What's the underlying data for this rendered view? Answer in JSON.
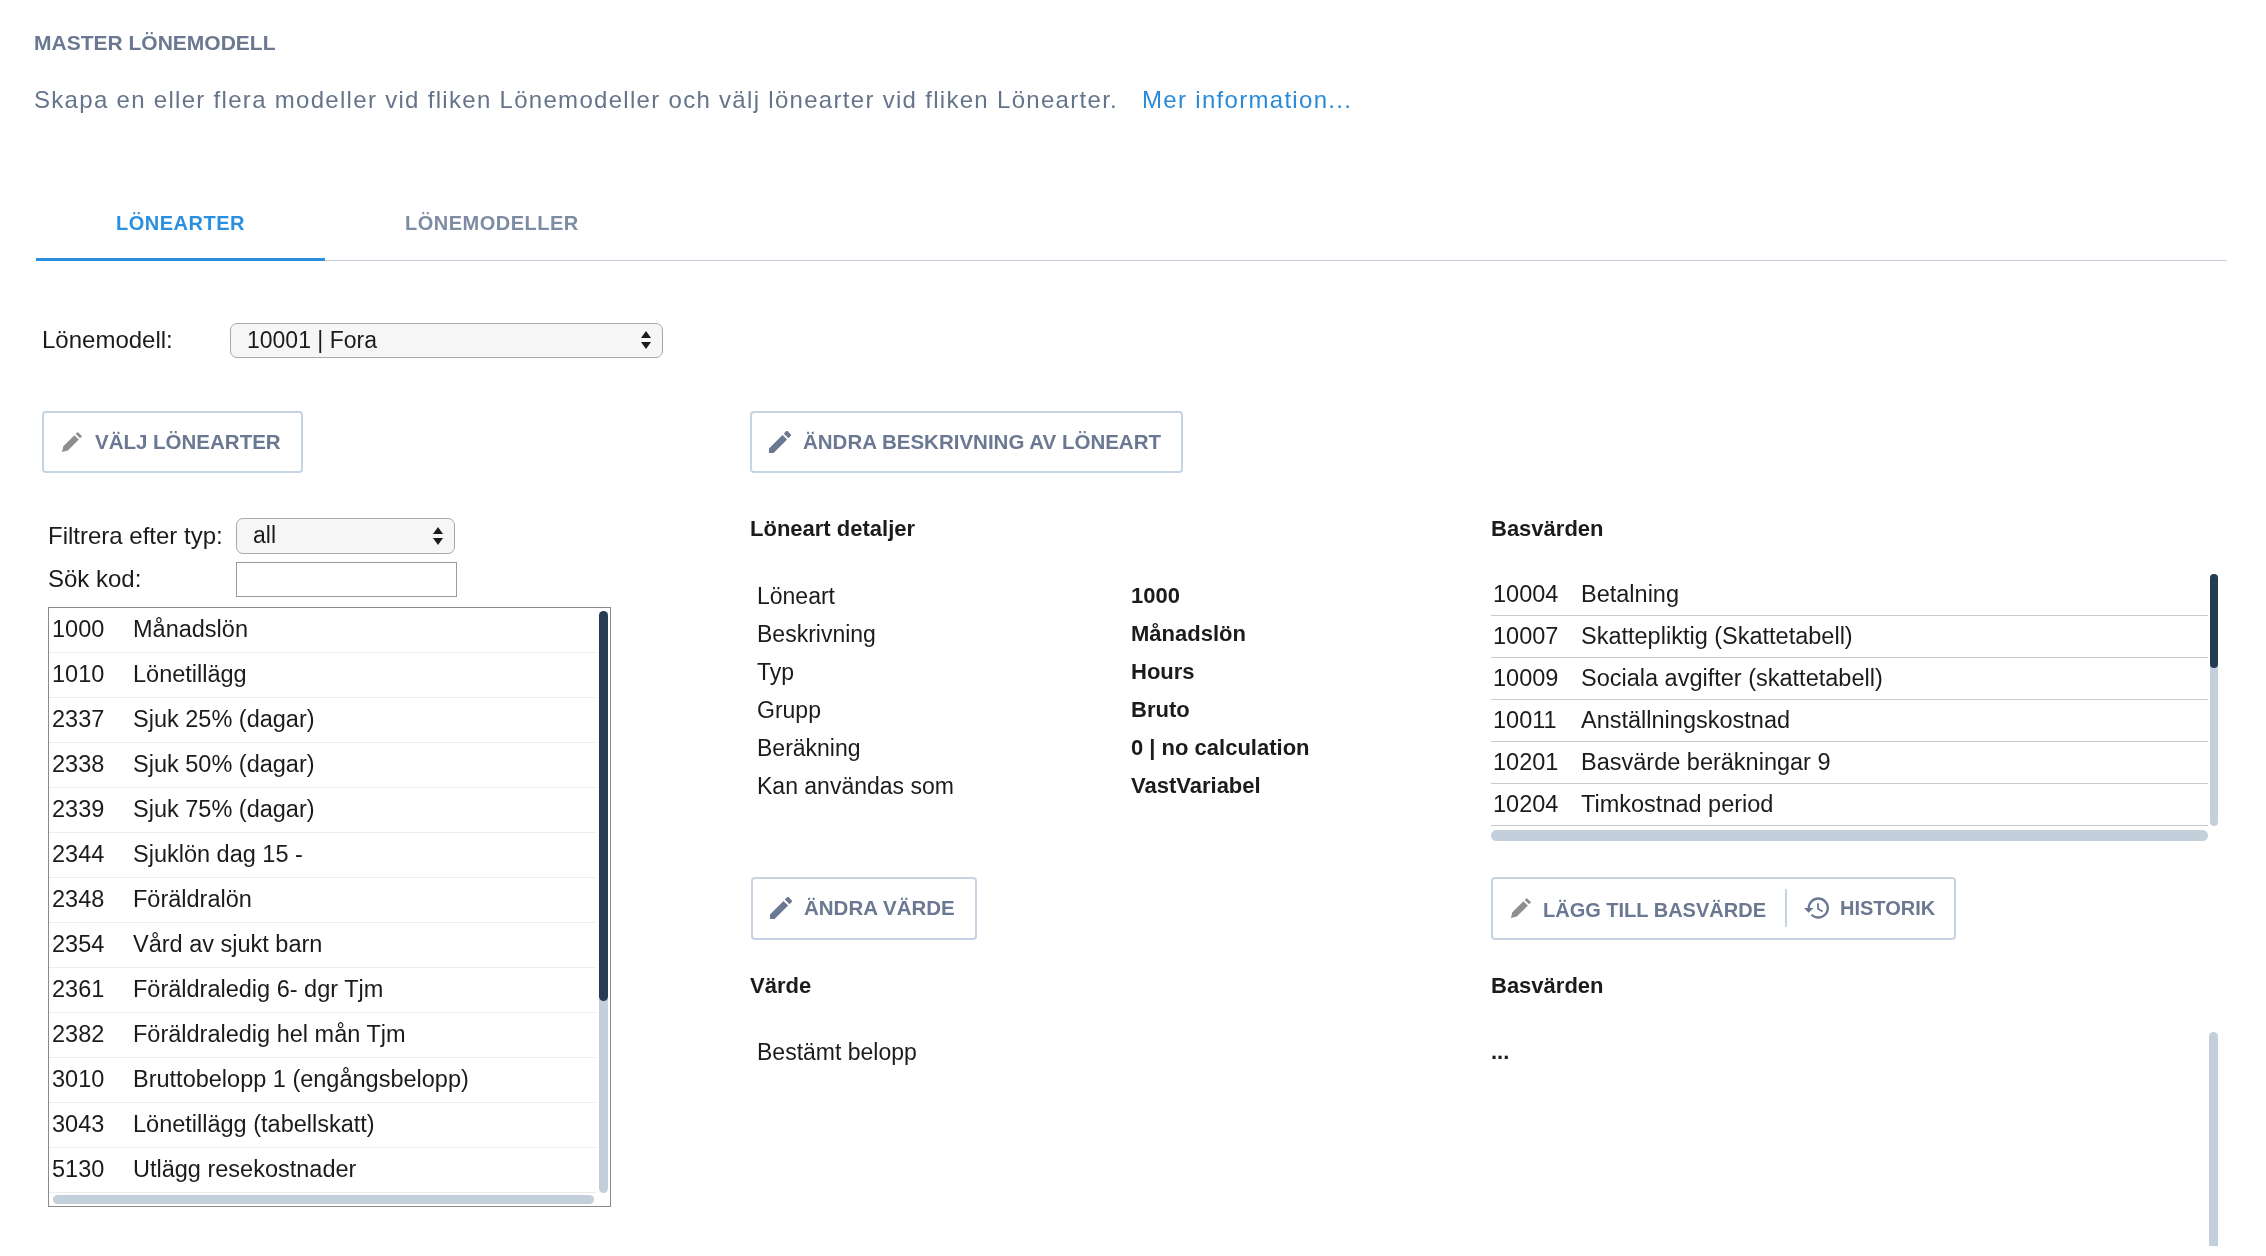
{
  "header": {
    "title": "MASTER LÖNEMODELL",
    "description": "Skapa en eller flera modeller vid fliken Lönemodeller och välj lönearter vid fliken Lönearter.",
    "link": "Mer information..."
  },
  "tabs": [
    {
      "label": "LÖNEARTER",
      "selected": true
    },
    {
      "label": "LÖNEMODELLER",
      "selected": false
    }
  ],
  "model_select": {
    "label": "Lönemodell:",
    "value": "10001 | Fora"
  },
  "wage_types": {
    "button": "VÄLJ LÖNEARTER",
    "filter": {
      "label": "Filtrera efter typ:",
      "value": "all"
    },
    "search": {
      "label": "Sök kod:"
    },
    "rows": [
      {
        "code": "1000",
        "name": "Månadslön"
      },
      {
        "code": "1010",
        "name": "Lönetillägg"
      },
      {
        "code": "2337",
        "name": "Sjuk 25% (dagar)"
      },
      {
        "code": "2338",
        "name": "Sjuk 50% (dagar)"
      },
      {
        "code": "2339",
        "name": "Sjuk 75% (dagar)"
      },
      {
        "code": "2344",
        "name": "Sjuklön dag 15 -"
      },
      {
        "code": "2348",
        "name": "Föräldralön"
      },
      {
        "code": "2354",
        "name": "Vård av sjukt barn"
      },
      {
        "code": "2361",
        "name": "Föräldraledig 6- dgr Tjm"
      },
      {
        "code": "2382",
        "name": "Föräldraledig hel mån Tjm"
      },
      {
        "code": "3010",
        "name": "Bruttobelopp 1 (engångsbelopp)"
      },
      {
        "code": "3043",
        "name": "Lönetillägg (tabellskatt)"
      },
      {
        "code": "5130",
        "name": "Utlägg resekostnader"
      }
    ]
  },
  "details": {
    "button": "ÄNDRA BESKRIVNING AV LÖNEART",
    "title": "Löneart detaljer",
    "rows": [
      {
        "label": "Löneart",
        "value": "1000"
      },
      {
        "label": "Beskrivning",
        "value": "Månadslön"
      },
      {
        "label": "Typ",
        "value": "Hours"
      },
      {
        "label": "Grupp",
        "value": "Bruto"
      },
      {
        "label": "Beräkning",
        "value": "0 | no calculation"
      },
      {
        "label": "Kan användas som",
        "value": "VastVariabel"
      }
    ]
  },
  "base_values": {
    "title": "Basvärden",
    "rows": [
      {
        "code": "10004",
        "name": "Betalning"
      },
      {
        "code": "10007",
        "name": "Skattepliktig (Skattetabell)"
      },
      {
        "code": "10009",
        "name": "Sociala avgifter (skattetabell)"
      },
      {
        "code": "10011",
        "name": "Anställningskostnad"
      },
      {
        "code": "10201",
        "name": "Basvärde beräkningar 9"
      },
      {
        "code": "10204",
        "name": "Timkostnad period"
      }
    ]
  },
  "value": {
    "button": "ÄNDRA VÄRDE",
    "title": "Värde",
    "text": "Bestämt belopp"
  },
  "base_value_actions": {
    "buttons": [
      {
        "kind": "add",
        "label": "LÄGG TILL BASVÄRDE"
      },
      {
        "kind": "history",
        "label": "HISTORIK"
      }
    ],
    "title": "Basvärden",
    "text": "..."
  }
}
